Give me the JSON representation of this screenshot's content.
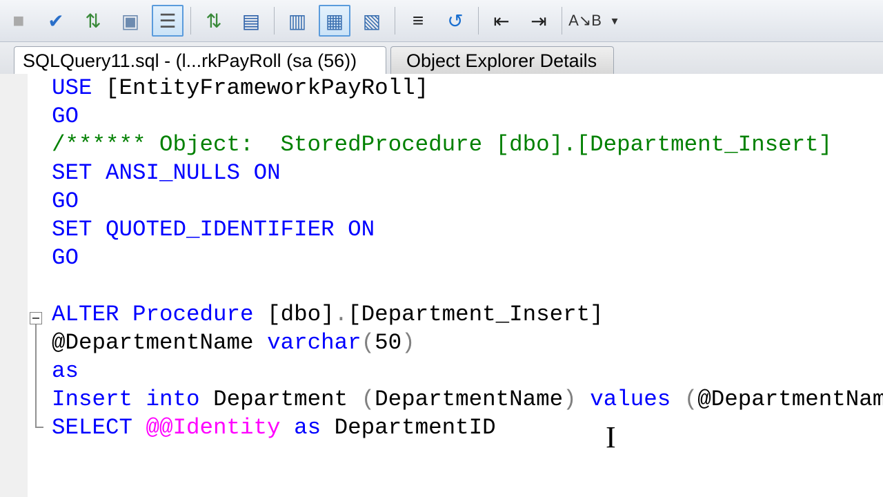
{
  "toolbar": {
    "icons": [
      "stop-icon",
      "parse-check-icon",
      "display-estimated-plan-icon",
      "query-designer-icon",
      "results-to-text-icon",
      "include-plan-icon",
      "client-stats-icon",
      "results-to-text-icon-2",
      "results-to-grid-icon",
      "results-to-file-icon",
      "comment-icon",
      "uncomment-icon",
      "decrease-indent-icon",
      "increase-indent-icon",
      "specify-values-icon",
      "overflow-icon"
    ]
  },
  "tabs": [
    {
      "label": "SQLQuery11.sql - (l...rkPayRoll (sa (56))",
      "active": true
    },
    {
      "label": "Object Explorer Details",
      "active": false
    }
  ],
  "code": [
    [
      [
        "USE ",
        "k"
      ],
      [
        "[EntityFrameworkPayRoll]",
        "t"
      ]
    ],
    [
      [
        "GO",
        "k"
      ]
    ],
    [
      [
        "/****** Object:  StoredProcedure [dbo].[Department_Insert]    S",
        "c"
      ]
    ],
    [
      [
        "SET ",
        "k"
      ],
      [
        "ANSI_NULLS ",
        "k"
      ],
      [
        "ON",
        "k"
      ]
    ],
    [
      [
        "GO",
        "k"
      ]
    ],
    [
      [
        "SET ",
        "k"
      ],
      [
        "QUOTED_IDENTIFIER ",
        "k"
      ],
      [
        "ON",
        "k"
      ]
    ],
    [
      [
        "GO",
        "k"
      ]
    ],
    [],
    [
      [
        "ALTER ",
        "k"
      ],
      [
        "Procedure ",
        "k"
      ],
      [
        "[dbo]",
        "t"
      ],
      [
        ".",
        "g"
      ],
      [
        "[Department_Insert]",
        "t"
      ]
    ],
    [
      [
        "@DepartmentName ",
        "t"
      ],
      [
        "varchar",
        "k"
      ],
      [
        "(",
        "g"
      ],
      [
        "50",
        "t"
      ],
      [
        ")",
        "g"
      ]
    ],
    [
      [
        "as",
        "k"
      ]
    ],
    [
      [
        "Insert ",
        "k"
      ],
      [
        "into ",
        "k"
      ],
      [
        "Department ",
        "t"
      ],
      [
        "(",
        "g"
      ],
      [
        "DepartmentName",
        "t"
      ],
      [
        ") ",
        "g"
      ],
      [
        "values ",
        "k"
      ],
      [
        "(",
        "g"
      ],
      [
        "@DepartmentName",
        "t"
      ]
    ],
    [
      [
        "SELECT ",
        "k"
      ],
      [
        "@@Identity ",
        "m"
      ],
      [
        "as ",
        "k"
      ],
      [
        "DepartmentID",
        "t"
      ]
    ]
  ]
}
